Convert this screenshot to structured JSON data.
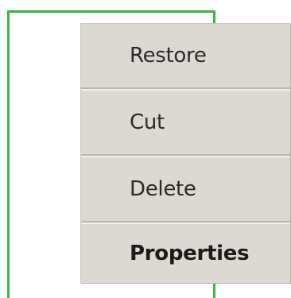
{
  "context_menu": {
    "items": [
      {
        "label": "Restore",
        "bold": false
      },
      {
        "label": "Cut",
        "bold": false
      },
      {
        "label": "Delete",
        "bold": false
      },
      {
        "label": "Properties",
        "bold": true
      }
    ]
  },
  "colors": {
    "frame_line": "#3fb24a",
    "menu_background": "#dcd9d2",
    "text": "#2a2a2a"
  }
}
